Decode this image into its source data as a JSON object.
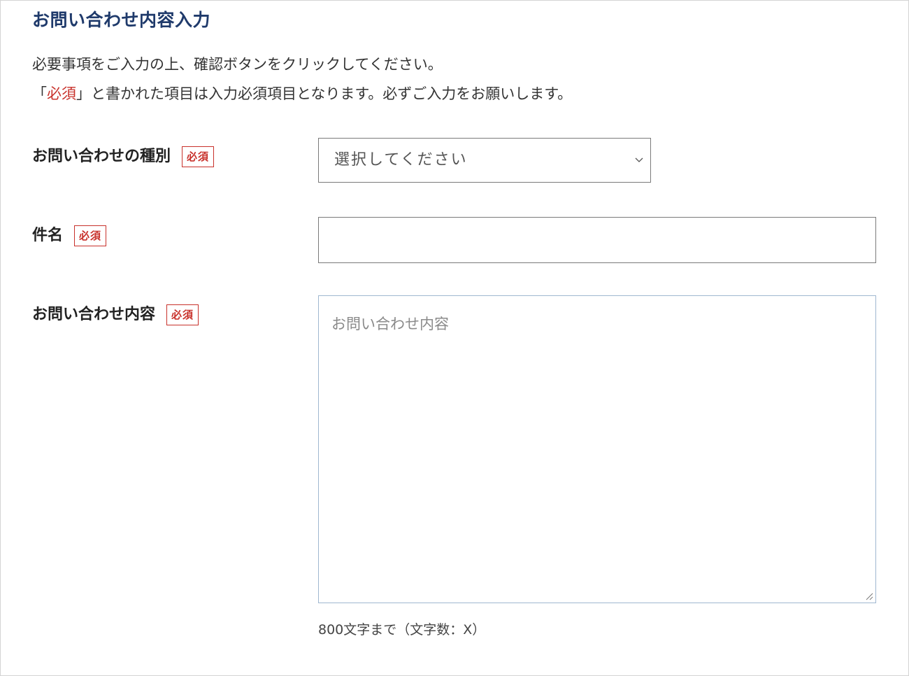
{
  "form": {
    "heading": "お問い合わせ内容入力",
    "intro": {
      "line1": "必要事項をご入力の上、確認ボタンをクリックしてください。",
      "line2_open": "「",
      "line2_required": "必須",
      "line2_rest": "」と書かれた項目は入力必須項目となります。必ずご入力をお願いします。"
    },
    "required_badge": "必須",
    "fields": {
      "inquiry_type": {
        "label": "お問い合わせの種別",
        "selected": "選択してください"
      },
      "subject": {
        "label": "件名",
        "value": ""
      },
      "content": {
        "label": "お問い合わせ内容",
        "placeholder": "お問い合わせ内容",
        "counter": "800文字まで（文字数：X）"
      }
    }
  },
  "colors": {
    "heading": "#1f3a6b",
    "required": "#c8312b",
    "input_border": "#7a7a7a",
    "textarea_border": "#9fb7d0"
  },
  "icons": {
    "select_arrow": "chevron-down-icon",
    "textarea_resize": "resize-handle-icon"
  }
}
